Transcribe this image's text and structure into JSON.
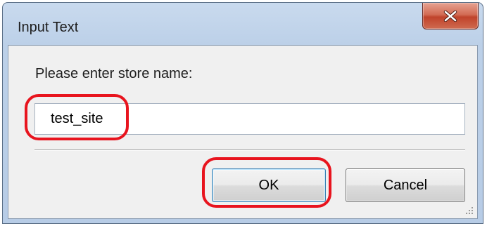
{
  "window": {
    "title": "Input Text",
    "close_icon": "close-icon"
  },
  "dialog": {
    "prompt": "Please enter store name:",
    "input_value": "test_site",
    "ok_label": "OK",
    "cancel_label": "Cancel"
  },
  "colors": {
    "annotation": "#e8141e",
    "close_button": "#c0432b"
  }
}
